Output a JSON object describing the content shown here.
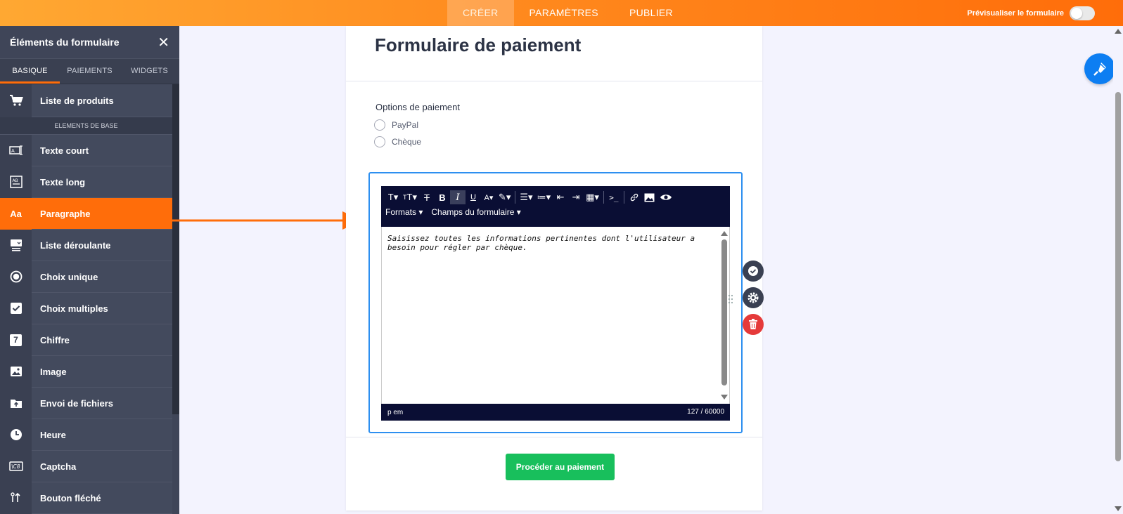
{
  "topbar": {
    "tabs": [
      {
        "label": "CRÉER"
      },
      {
        "label": "PARAMÈTRES"
      },
      {
        "label": "PUBLIER"
      }
    ],
    "preview_label": "Prévisualiser le formulaire",
    "preview_enabled": false
  },
  "sidebar": {
    "title": "Éléments du formulaire",
    "close_icon": "close-icon",
    "tabs": [
      {
        "label": "BASIQUE"
      },
      {
        "label": "PAIEMENTS"
      },
      {
        "label": "WIDGETS"
      }
    ],
    "first_item": {
      "label": "Liste de produits",
      "icon": "cart-icon"
    },
    "section_label": "ELEMENTS DE BASE",
    "items": [
      {
        "label": "Texte court",
        "icon": "short-text-icon"
      },
      {
        "label": "Texte long",
        "icon": "long-text-icon"
      },
      {
        "label": "Paragraphe",
        "icon": "paragraph-icon",
        "icon_text": "Aa"
      },
      {
        "label": "Liste déroulante",
        "icon": "dropdown-icon"
      },
      {
        "label": "Choix unique",
        "icon": "radio-icon"
      },
      {
        "label": "Choix multiples",
        "icon": "checkbox-icon"
      },
      {
        "label": "Chiffre",
        "icon": "number-icon",
        "icon_text": "7"
      },
      {
        "label": "Image",
        "icon": "image-icon"
      },
      {
        "label": "Envoi de fichiers",
        "icon": "upload-icon"
      },
      {
        "label": "Heure",
        "icon": "clock-icon"
      },
      {
        "label": "Captcha",
        "icon": "captcha-icon"
      },
      {
        "label": "Bouton fléché",
        "icon": "arrow-button-icon"
      }
    ]
  },
  "form": {
    "title": "Formulaire de paiement",
    "options_label": "Options de paiement",
    "options": [
      "PayPal",
      "Chèque"
    ],
    "editor": {
      "formats_label": "Formats",
      "fields_label": "Champs du formulaire",
      "content": "Saisissez toutes les informations pertinentes dont l'utilisateur a besoin pour régler par chèque.",
      "path": "p  em",
      "char_count": "127 / 60000"
    },
    "submit_label": "Procéder au paiement"
  },
  "colors": {
    "accent": "#ff6d0a",
    "sidebar_bg": "#3f4558",
    "editor_bg": "#0a0e34",
    "submit": "#18bf5c",
    "delete": "#e53a3a",
    "paint": "#0d7ef2"
  }
}
